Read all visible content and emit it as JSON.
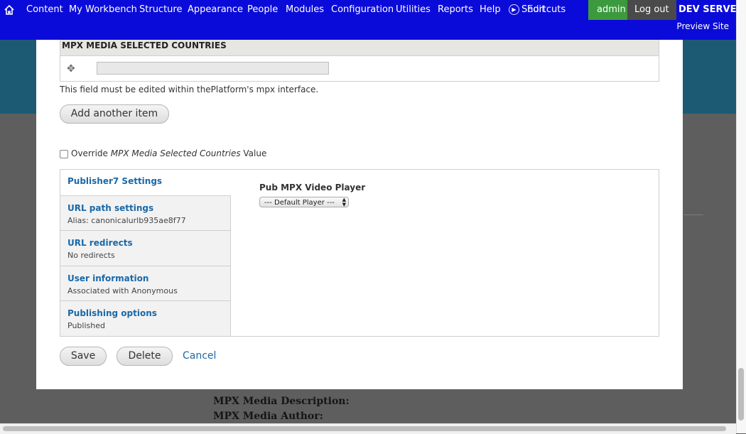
{
  "toolbar": {
    "home_icon": "home-icon",
    "menu": [
      "Content",
      "My Workbench",
      "Structure",
      "Appearance",
      "People",
      "Modules",
      "Configuration",
      "Utilities",
      "Reports",
      "Help"
    ],
    "shortcuts_icon": "arrow-circle-icon",
    "shortcuts_label": "Shortcuts",
    "edit_label": "Edit",
    "admin_label": "admin",
    "logout_label": "Log out",
    "server_label": "DEV SERVER",
    "preview_label": "Preview Site"
  },
  "modal": {
    "table_header": "MPX MEDIA SELECTED COUNTRIES",
    "drag_icon": "drag-handle-icon",
    "field_value": "",
    "field_description": "This field must be edited within thePlatform's mpx interface.",
    "add_item_label": "Add another item",
    "override_prefix": "Override ",
    "override_field": "MPX Media Selected Countries",
    "override_suffix": " Value",
    "override_checked": false,
    "tabs": [
      {
        "title": "Publisher7 Settings",
        "summary": ""
      },
      {
        "title": "URL path settings",
        "summary": "Alias: canonicalurlb935ae8f77"
      },
      {
        "title": "URL redirects",
        "summary": "No redirects"
      },
      {
        "title": "User information",
        "summary": "Associated with Anonymous"
      },
      {
        "title": "Publishing options",
        "summary": "Published"
      }
    ],
    "pane": {
      "label": "Pub MPX Video Player",
      "select_value": "--- Default Player ---"
    },
    "save_label": "Save",
    "delete_label": "Delete",
    "cancel_label": "Cancel"
  },
  "background": {
    "lines": [
      "MPX Media Description:",
      "MPX Media Author:"
    ]
  },
  "colors": {
    "toolbar": "#0b0bd9",
    "admin": "#3c9a3e",
    "link": "#1a68a7"
  }
}
